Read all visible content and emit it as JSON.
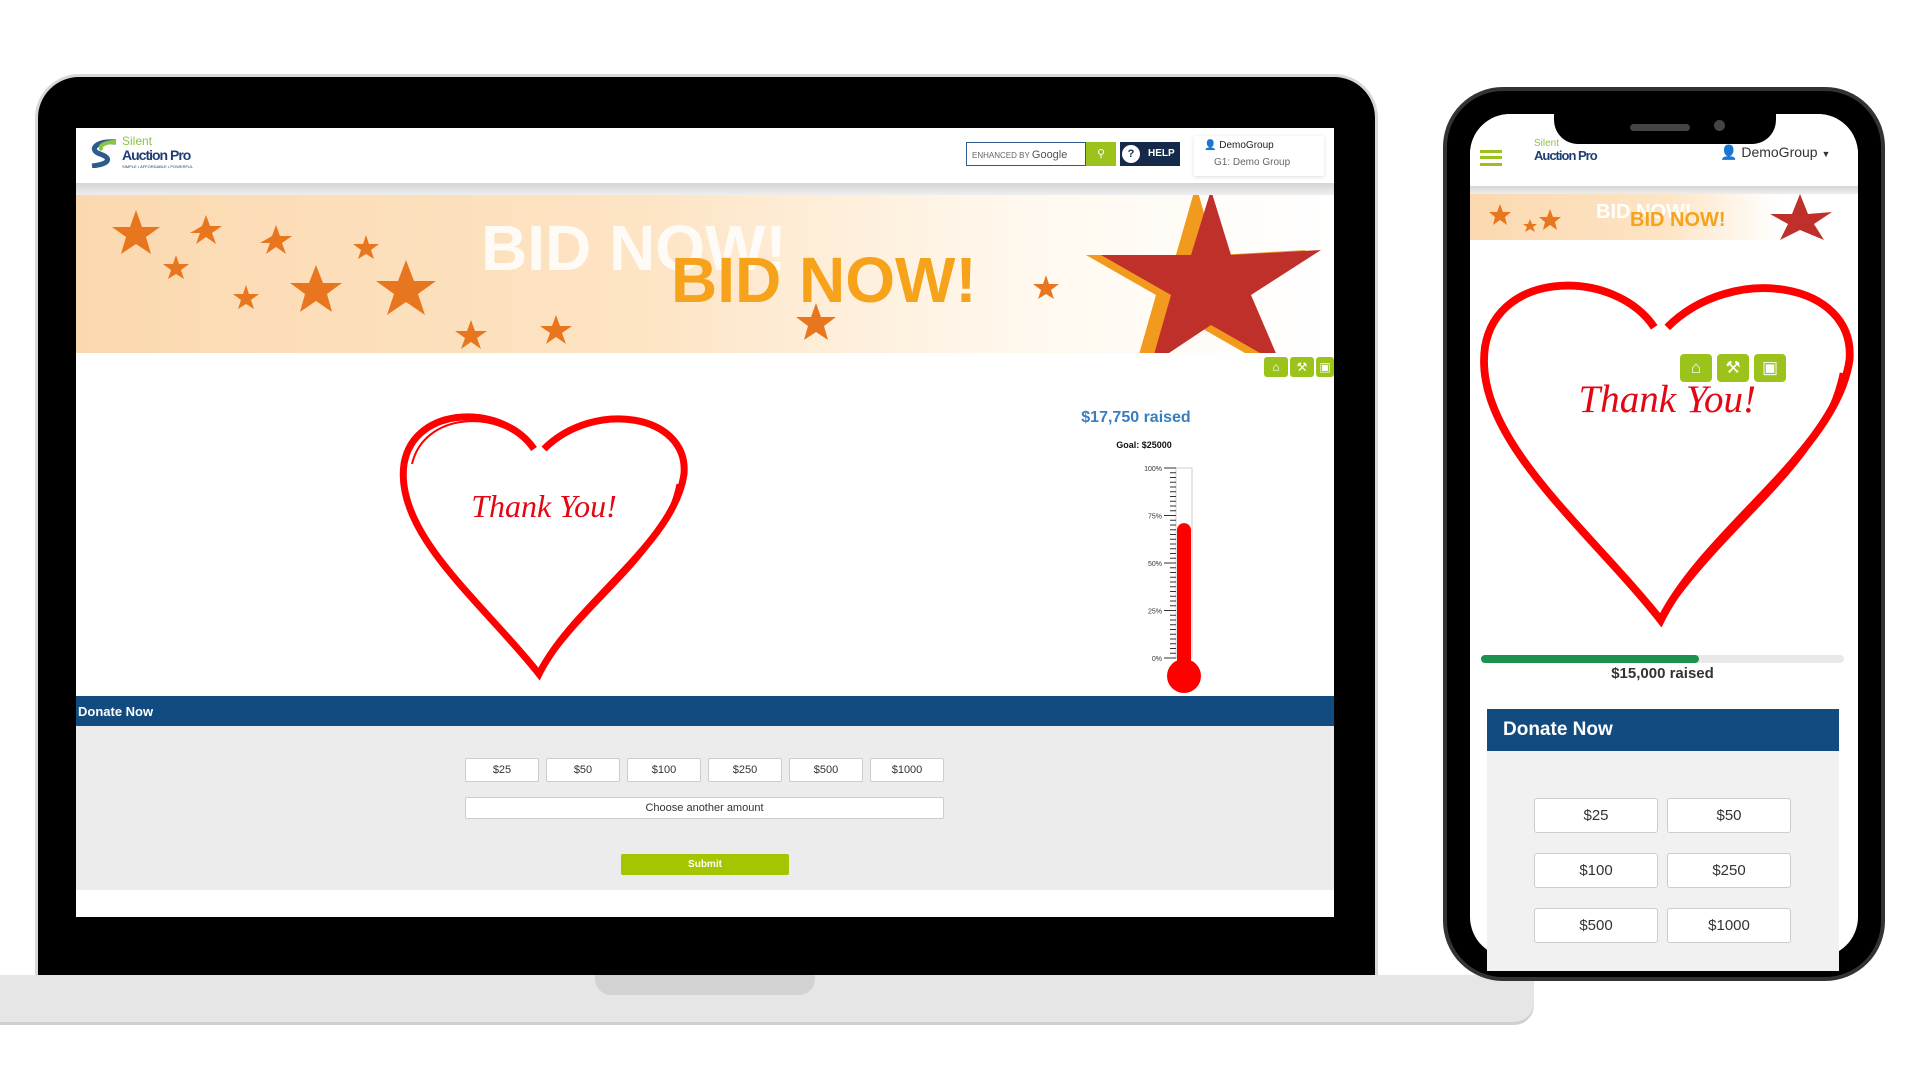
{
  "laptop": {
    "logo": {
      "line1": "Silent",
      "line2": "Auction Pro",
      "tagline": "SIMPLE • AFFORDABLE • POWERFUL"
    },
    "search": {
      "enhanced": "ENHANCED BY",
      "brand": "Google",
      "button_icon": "search-icon"
    },
    "help_label": "HELP",
    "user": {
      "name": "DemoGroup",
      "group": "G1: Demo Group"
    },
    "banner": {
      "ghost_text": "BID NOW!",
      "text": "BID NOW!"
    },
    "nav_icons": [
      "home-icon",
      "gavel-icon",
      "ticket-icon"
    ],
    "thank_you": "Thank You!",
    "raised": "$17,750 raised",
    "goal": "Goal: $25000",
    "thermometer": {
      "percent": 71,
      "ticks": [
        "100%",
        "75%",
        "50%",
        "25%",
        "0%"
      ],
      "color": "#ff0000"
    },
    "donate_title": "Donate Now",
    "amounts": [
      "$25",
      "$50",
      "$100",
      "$250",
      "$500",
      "$1000"
    ],
    "other_amount": "Choose another amount",
    "submit": "Submit"
  },
  "phone": {
    "logo": {
      "line1": "Silent",
      "line2": "Auction Pro"
    },
    "user": "DemoGroup",
    "banner": {
      "ghost_text": "BID NOW!",
      "text": "BID NOW!"
    },
    "thank_you": "Thank You!",
    "progress_percent": 60,
    "raised": "$15,000 raised",
    "donate_title": "Donate Now",
    "amounts": [
      "$25",
      "$50",
      "$100",
      "$250",
      "$500",
      "$1000"
    ]
  },
  "colors": {
    "brand_blue": "#114b80",
    "accent_green": "#9bc31b",
    "progress_green": "#1e9150",
    "heart_red": "#ff0000"
  }
}
